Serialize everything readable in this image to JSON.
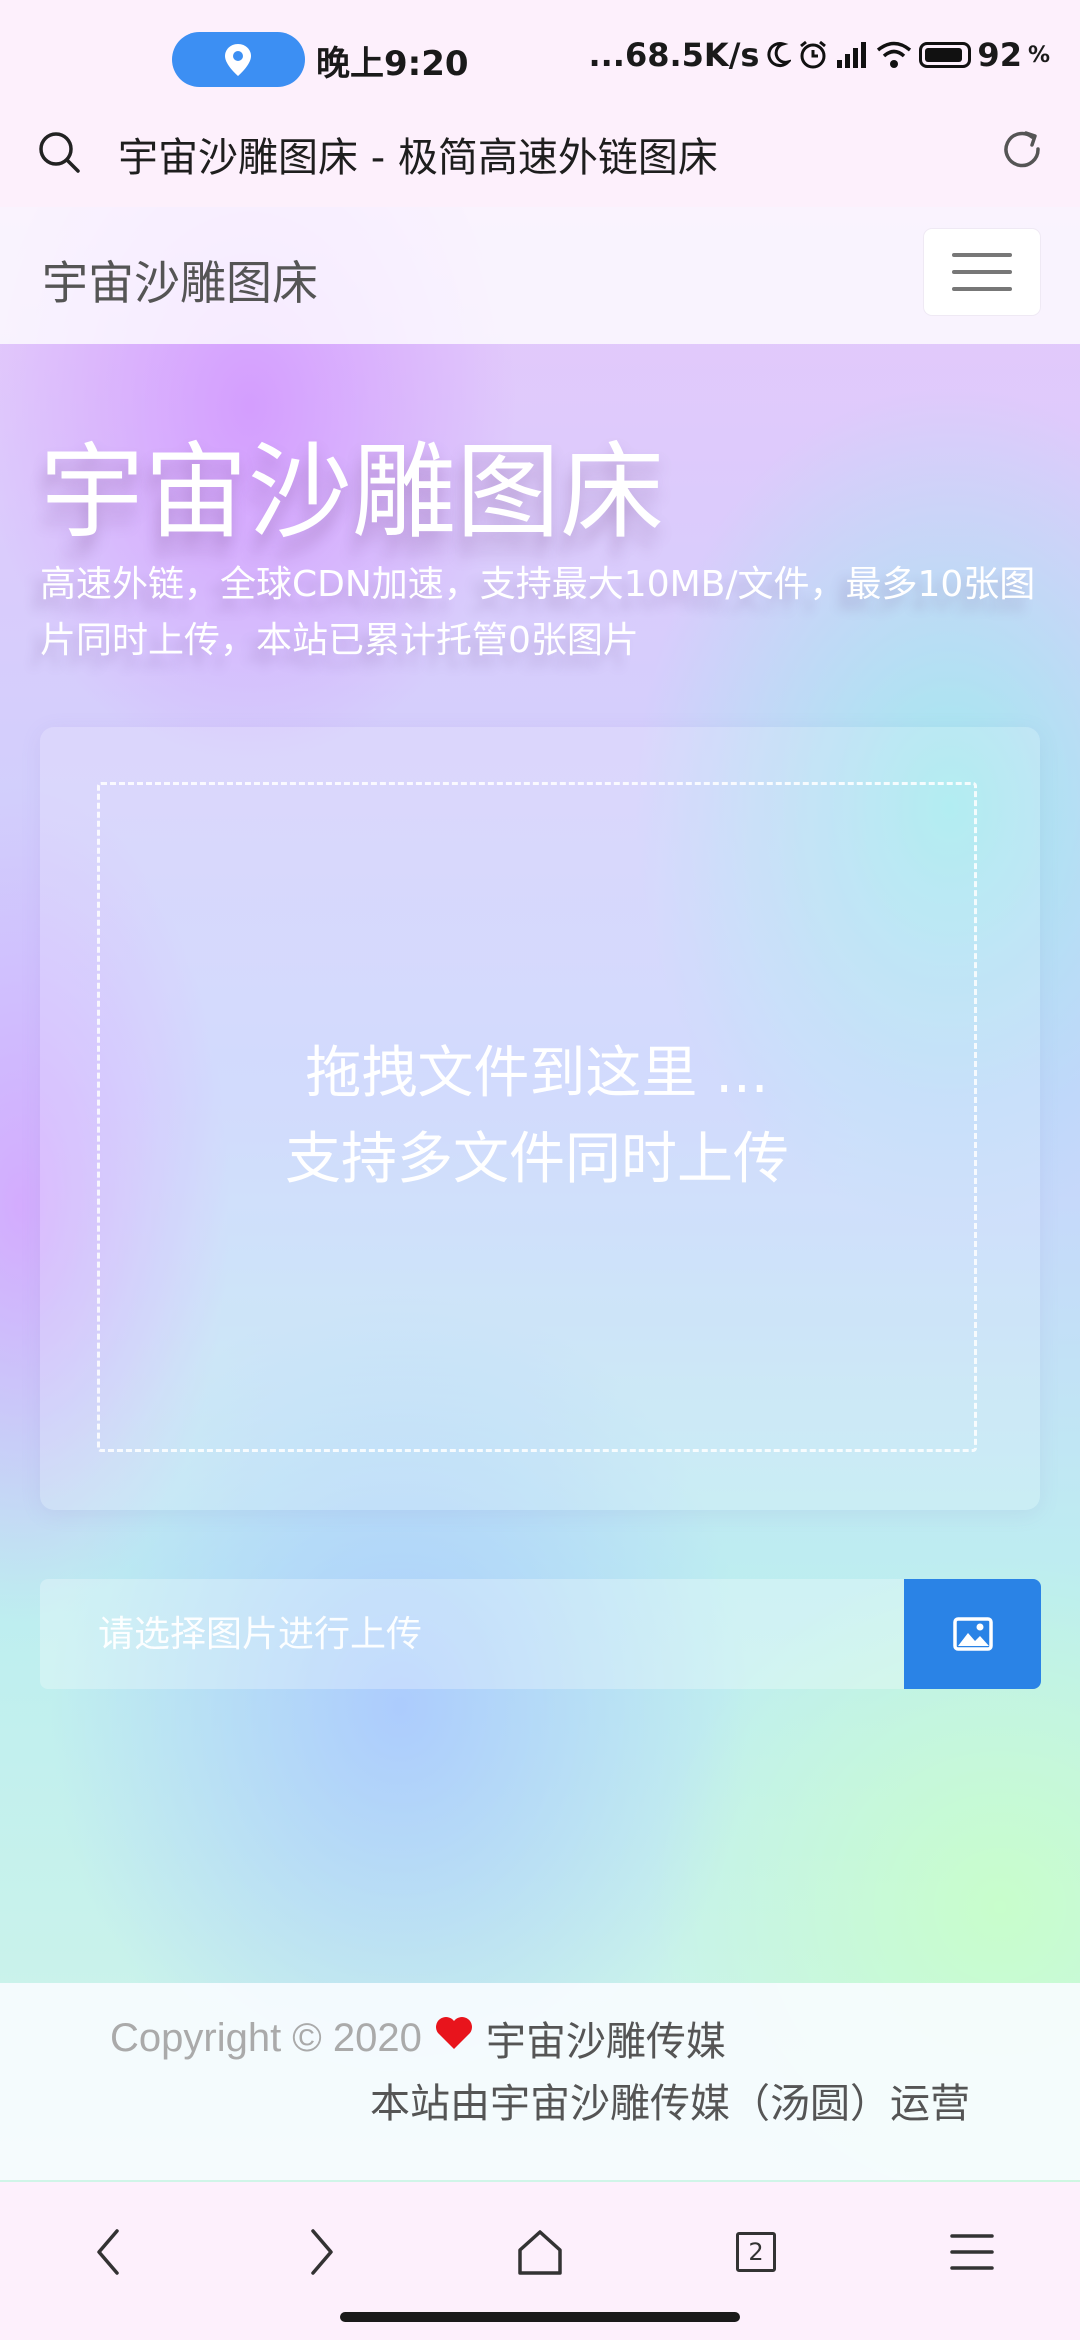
{
  "status_bar": {
    "time": "晚上9:20",
    "network_speed": "...68.5K/s",
    "battery_percent": "92",
    "battery_symbol": "%",
    "icons": [
      "location-icon",
      "moon-icon",
      "alarm-icon",
      "signal-icon",
      "wifi-icon",
      "battery-icon"
    ]
  },
  "browser": {
    "title": "宇宙沙雕图床 - 极简高速外链图床",
    "tab_count": "2"
  },
  "navbar": {
    "brand": "宇宙沙雕图床"
  },
  "hero": {
    "title": "宇宙沙雕图床",
    "subtitle": "高速外链，全球CDN加速，支持最大10MB/文件，最多10张图片同时上传，本站已累计托管0张图片"
  },
  "upload": {
    "drop_line1": "拖拽文件到这里 ...",
    "drop_line2": "支持多文件同时上传",
    "input_placeholder": "请选择图片进行上传"
  },
  "footer": {
    "copyright": "Copyright © 2020",
    "company": "宇宙沙雕传媒",
    "operated_by": "本站由宇宙沙雕传媒（汤圆）运营"
  },
  "colors": {
    "accent": "#2a83e6",
    "heart": "#e8141c",
    "location_pill": "#3c8ff3"
  }
}
